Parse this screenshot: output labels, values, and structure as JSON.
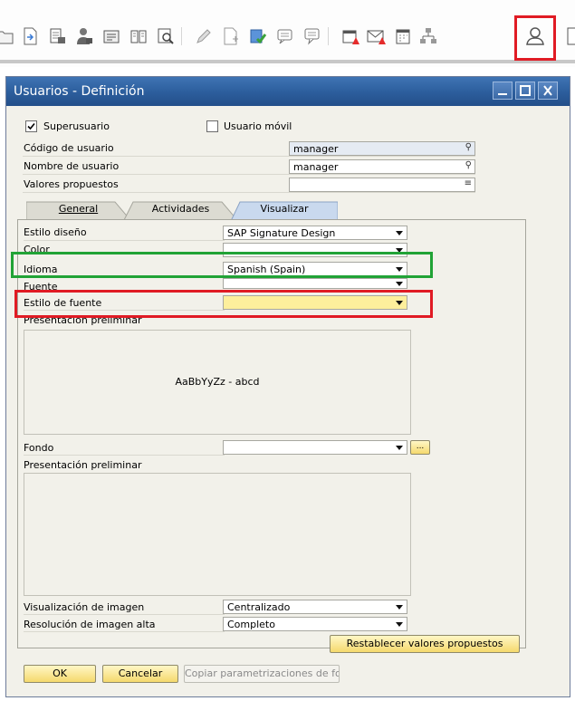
{
  "toolbar": {
    "icons": [
      "open-folder-icon",
      "document-arrow-icon",
      "print-preview-icon",
      "user-lock-icon",
      "scan-icon",
      "book-icon",
      "zoom-doc-icon",
      "pencil-icon",
      "new-doc-icon",
      "database-check-icon",
      "message-icon",
      "chat-icon",
      "alert-calendar-icon",
      "mail-icon",
      "calendar-icon",
      "org-chart-icon",
      "user-icon"
    ]
  },
  "window": {
    "title": "Usuarios - Definición"
  },
  "header": {
    "superuser_label": "Superusuario",
    "superuser_checked": true,
    "mobile_user_label": "Usuario móvil",
    "mobile_user_checked": false,
    "user_code_label": "Código de usuario",
    "user_code_value": "manager",
    "user_name_label": "Nombre de usuario",
    "user_name_value": "manager",
    "defaults_label": "Valores propuestos",
    "defaults_value": ""
  },
  "tabs": [
    {
      "label": "General",
      "active": false
    },
    {
      "label": "Actividades",
      "active": false
    },
    {
      "label": "Visualizar",
      "active": true
    }
  ],
  "display": {
    "design_style_label": "Estilo diseño",
    "design_style_value": "SAP Signature Design",
    "color_label": "Color",
    "color_value": "",
    "language_label": "Idioma",
    "language_value": "Spanish (Spain)",
    "font_label": "Fuente",
    "font_value": "",
    "font_style_label": "Estilo de fuente",
    "font_style_value": "",
    "preview_label": "Presentación preliminar",
    "preview_sample": "AaBbYyZz - abcd",
    "background_label": "Fondo",
    "background_value": "",
    "browse_button": "...",
    "preview2_label": "Presentación preliminar",
    "image_display_label": "Visualización de imagen",
    "image_display_value": "Centralizado",
    "hires_label": "Resolución de imagen alta",
    "hires_value": "Completo",
    "restore_button": "Restablecer valores propuestos"
  },
  "footer": {
    "ok_button": "OK",
    "cancel_button": "Cancelar",
    "copy_button": "Copiar parametrizaciones de fo"
  },
  "colors": {
    "titlebar": "#2d5f9e",
    "highlight_green": "#21a336",
    "highlight_red": "#e01b24",
    "selected_field": "#fdef9c"
  }
}
